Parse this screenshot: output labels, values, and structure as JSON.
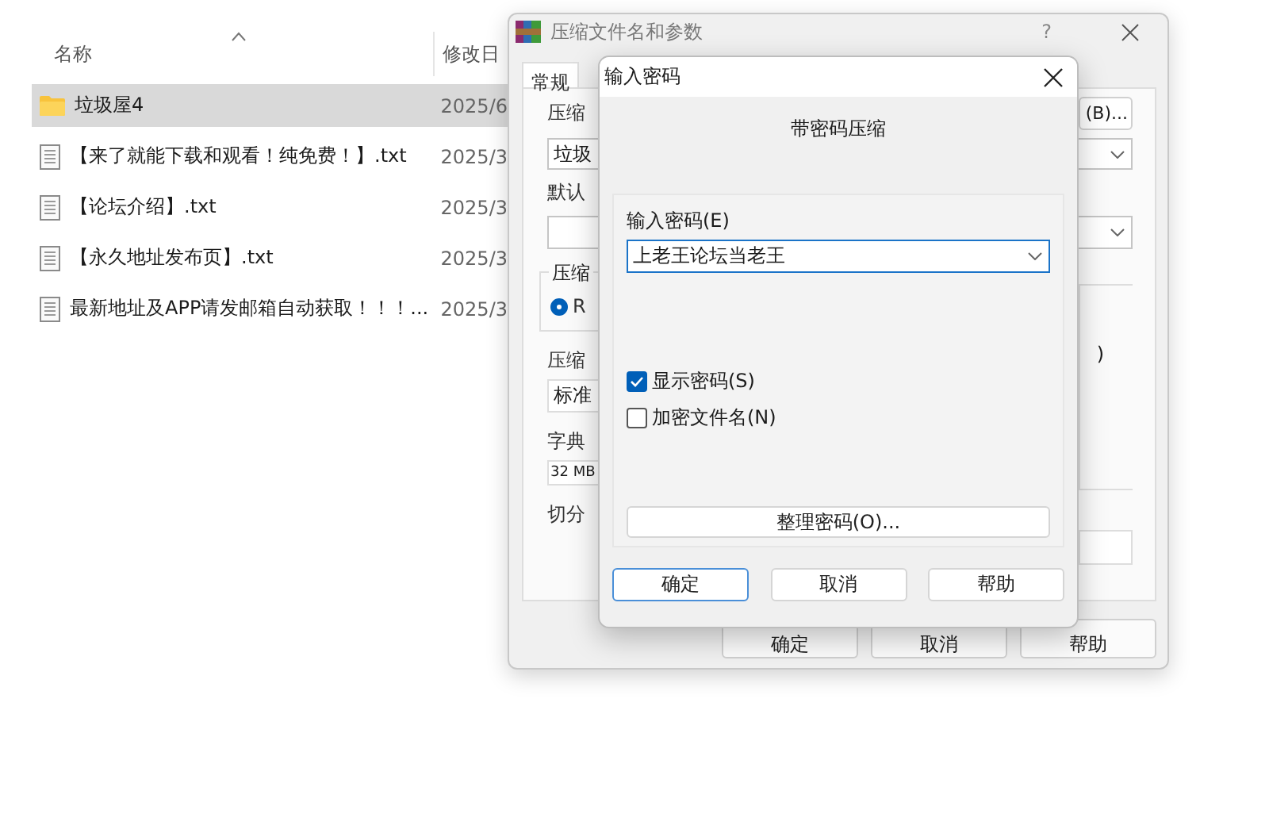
{
  "explorer": {
    "columns": [
      {
        "label": "名称",
        "sorted": true
      },
      {
        "label": "修改日",
        "sorted": false
      }
    ],
    "rows": [
      {
        "kind": "folder",
        "name": "垃圾屋4",
        "date": "2025/6",
        "selected": true
      },
      {
        "kind": "text",
        "name": "【来了就能下载和观看！纯免费！】.txt",
        "date": "2025/3",
        "selected": false
      },
      {
        "kind": "text",
        "name": "【论坛介绍】.txt",
        "date": "2025/3",
        "selected": false
      },
      {
        "kind": "text",
        "name": "【永久地址发布页】.txt",
        "date": "2025/3",
        "selected": false
      },
      {
        "kind": "text",
        "name": "最新地址及APP请发邮箱自动获取！！！...",
        "date": "2025/3",
        "selected": false
      }
    ]
  },
  "archive_dialog": {
    "title": "压缩文件名和参数",
    "help_glyph": "?",
    "tabs": [
      {
        "label": "常规",
        "selected": true
      }
    ],
    "archive_name_label": "压缩",
    "browse_button": "(B)...",
    "archive_name": "垃圾",
    "profile_label": "默认",
    "format_group": "压缩",
    "format_options": [
      {
        "label": "R",
        "selected": true
      }
    ],
    "method_label": "压缩",
    "method": "标准",
    "dictionary_label": "字典",
    "dictionary": "32 MB",
    "split_label": "切分",
    "options_group_fragment": ")",
    "buttons": [
      "确定",
      "取消",
      "帮助"
    ]
  },
  "password_dialog": {
    "title": "输入密码",
    "heading": "带密码压缩",
    "password_label": "输入密码(E)",
    "password": "上老王论坛当老王",
    "options": [
      {
        "label": "显示密码(S)",
        "checked": true
      },
      {
        "label": "加密文件名(N)",
        "checked": false
      }
    ],
    "organize_button": "整理密码(O)...",
    "buttons": [
      {
        "label": "确定",
        "default": true
      },
      {
        "label": "取消",
        "default": false
      },
      {
        "label": "帮助",
        "default": false
      }
    ]
  }
}
